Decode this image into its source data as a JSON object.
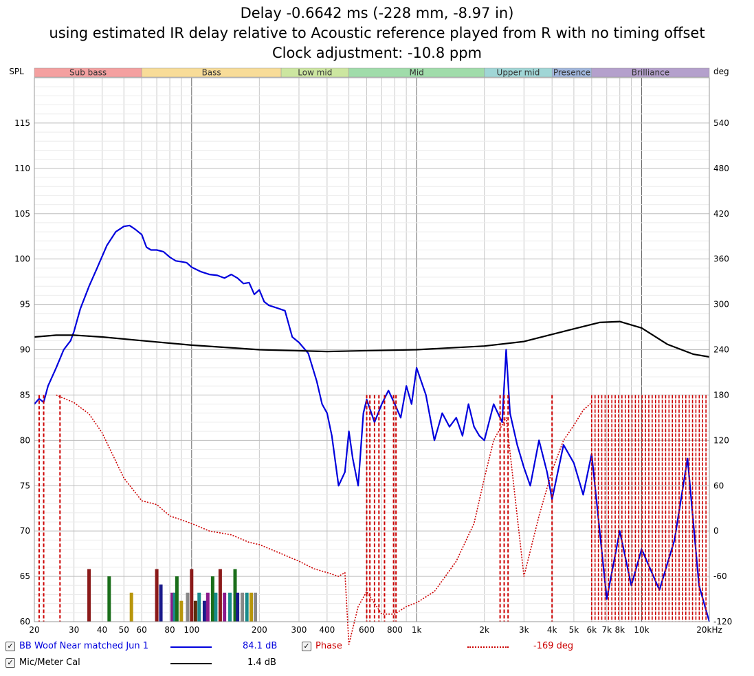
{
  "header": {
    "line1": "Delay -0.6642 ms (-228 mm, -8.97 in)",
    "line2": "using estimated IR delay relative to Acoustic reference played from R with no timing offset",
    "line3": "Clock adjustment: -10.8 ppm"
  },
  "chart_data": {
    "type": "line",
    "x_scale": "log",
    "xlim": [
      20,
      20000
    ],
    "ylim_left": [
      60,
      120
    ],
    "ylim_right": [
      -120,
      600
    ],
    "ylabel_left": "SPL",
    "ylabel_right": "deg",
    "grid": true,
    "x_ticks": [
      {
        "v": 20,
        "label": "20"
      },
      {
        "v": 30,
        "label": "30"
      },
      {
        "v": 40,
        "label": "40"
      },
      {
        "v": 50,
        "label": "50"
      },
      {
        "v": 60,
        "label": "60"
      },
      {
        "v": 80,
        "label": "80"
      },
      {
        "v": 100,
        "label": "100"
      },
      {
        "v": 200,
        "label": "200"
      },
      {
        "v": 300,
        "label": "300"
      },
      {
        "v": 400,
        "label": "400"
      },
      {
        "v": 600,
        "label": "600"
      },
      {
        "v": 800,
        "label": "800"
      },
      {
        "v": 1000,
        "label": "1k"
      },
      {
        "v": 2000,
        "label": "2k"
      },
      {
        "v": 3000,
        "label": "3k"
      },
      {
        "v": 4000,
        "label": "4k"
      },
      {
        "v": 5000,
        "label": "5k"
      },
      {
        "v": 6000,
        "label": "6k"
      },
      {
        "v": 7000,
        "label": "7k"
      },
      {
        "v": 8000,
        "label": "8k"
      },
      {
        "v": 10000,
        "label": "10k"
      },
      {
        "v": 20000,
        "label": "20kHz"
      }
    ],
    "y_left_ticks": [
      "115",
      "110",
      "105",
      "100",
      "95",
      "90",
      "85",
      "80",
      "75",
      "70",
      "65",
      "60"
    ],
    "y_right_ticks": [
      "540",
      "480",
      "420",
      "360",
      "300",
      "240",
      "180",
      "120",
      "60",
      "0",
      "-60",
      "-120"
    ],
    "bands": [
      {
        "name": "Sub bass",
        "from": 20,
        "to": 60,
        "color": "#f4a0a0"
      },
      {
        "name": "Bass",
        "from": 60,
        "to": 250,
        "color": "#f8dc98"
      },
      {
        "name": "Low mid",
        "from": 250,
        "to": 500,
        "color": "#cce6a0"
      },
      {
        "name": "Mid",
        "from": 500,
        "to": 2000,
        "color": "#a0dcaa"
      },
      {
        "name": "Upper mid",
        "from": 2000,
        "to": 4000,
        "color": "#a0d6d6"
      },
      {
        "name": "Presence",
        "from": 4000,
        "to": 6000,
        "color": "#a0b6dc"
      },
      {
        "name": "Brilliance",
        "from": 6000,
        "to": 20000,
        "color": "#b4a0cc"
      }
    ],
    "series": [
      {
        "name": "BB Woof Near matched Jun 1",
        "color": "#0000dd",
        "axis": "left",
        "value_label": "84.1 dB",
        "x": [
          20,
          21,
          22,
          23,
          25,
          27,
          29,
          30,
          32,
          35,
          38,
          42,
          46,
          50,
          53,
          56,
          60,
          63,
          66,
          70,
          75,
          80,
          85,
          90,
          95,
          100,
          110,
          120,
          130,
          140,
          150,
          160,
          170,
          180,
          190,
          200,
          210,
          220,
          240,
          260,
          280,
          300,
          330,
          360,
          380,
          400,
          420,
          450,
          480,
          500,
          520,
          550,
          580,
          600,
          650,
          700,
          750,
          800,
          850,
          900,
          950,
          1000,
          1100,
          1200,
          1300,
          1400,
          1500,
          1600,
          1700,
          1800,
          1900,
          2000,
          2200,
          2400,
          2500,
          2600,
          2800,
          3000,
          3200,
          3500,
          3800,
          4000,
          4500,
          5000,
          5500,
          6000,
          7000,
          8000,
          9000,
          10000,
          12000,
          14000,
          16000,
          18000,
          20000
        ],
        "y": [
          84.0,
          84.6,
          84.2,
          86.0,
          88.0,
          90.0,
          91.0,
          92.0,
          94.5,
          97.0,
          99.0,
          101.5,
          103.0,
          103.6,
          103.7,
          103.3,
          102.7,
          101.3,
          101.0,
          101.0,
          100.8,
          100.2,
          99.8,
          99.7,
          99.6,
          99.1,
          98.6,
          98.3,
          98.2,
          97.9,
          98.3,
          97.9,
          97.3,
          97.4,
          96.1,
          96.6,
          95.3,
          94.9,
          94.6,
          94.3,
          91.4,
          90.8,
          89.6,
          86.5,
          84.0,
          83.0,
          80.5,
          75.0,
          76.5,
          81.0,
          78.0,
          75.0,
          83.0,
          84.5,
          82.0,
          84.0,
          85.5,
          84.0,
          82.5,
          86.0,
          84.0,
          88.0,
          85.0,
          80.0,
          83.0,
          81.5,
          82.5,
          80.5,
          84.0,
          81.5,
          80.5,
          80.0,
          84.0,
          82.0,
          90.0,
          83.0,
          79.5,
          77.0,
          75.0,
          80.0,
          76.5,
          73.5,
          79.5,
          77.5,
          74.0,
          78.5,
          62.5,
          70.0,
          64.0,
          68.0,
          63.5,
          69.0,
          78.0,
          64.0,
          60.0
        ]
      },
      {
        "name": "Mic/Meter Cal",
        "color": "#000000",
        "axis": "left",
        "value_label": "1.4 dB",
        "x": [
          20,
          25,
          30,
          40,
          60,
          100,
          200,
          400,
          1000,
          2000,
          3000,
          5000,
          6500,
          8000,
          10000,
          13000,
          17000,
          20000
        ],
        "y": [
          91.4,
          91.6,
          91.6,
          91.4,
          91.0,
          90.5,
          90.0,
          89.8,
          90.0,
          90.4,
          90.9,
          92.3,
          93.0,
          93.1,
          92.4,
          90.6,
          89.5,
          89.2
        ]
      },
      {
        "name": "Phase",
        "color": "#cc0000",
        "axis": "right",
        "value_label": "-169 deg",
        "x": [
          25,
          30,
          35,
          40,
          50,
          60,
          70,
          80,
          100,
          120,
          150,
          180,
          200,
          250,
          300,
          350,
          400,
          450,
          480,
          500,
          550,
          600,
          700,
          800,
          900,
          1000,
          1200,
          1500,
          1800,
          2000,
          2200,
          2500,
          3000,
          3500,
          4000,
          4500,
          5000,
          5500,
          6000
        ],
        "y": [
          180,
          170,
          155,
          130,
          70,
          40,
          35,
          20,
          10,
          0,
          -5,
          -15,
          -18,
          -30,
          -40,
          -50,
          -55,
          -60,
          -55,
          -150,
          -100,
          -80,
          -110,
          -110,
          -100,
          -95,
          -80,
          -40,
          10,
          70,
          120,
          150,
          -60,
          20,
          80,
          120,
          140,
          160,
          170
        ]
      }
    ],
    "legend": {
      "placement": "bottom-left",
      "entries": [
        {
          "name": "BB Woof Near matched Jun 1",
          "value": "84.1 dB",
          "checked": true
        },
        {
          "name": "Mic/Meter Cal",
          "value": "1.4 dB",
          "checked": true
        },
        {
          "name": "Phase",
          "value": "-169 deg",
          "checked": true
        }
      ]
    }
  },
  "legend_ui": {
    "entry1_label": "BB Woof Near matched Jun 1",
    "entry1_value": "84.1 dB",
    "entry2_label": "Mic/Meter Cal",
    "entry2_value": "1.4 dB",
    "entry3_label": "Phase",
    "entry3_value": "-169 deg",
    "check_glyph": "✓"
  }
}
